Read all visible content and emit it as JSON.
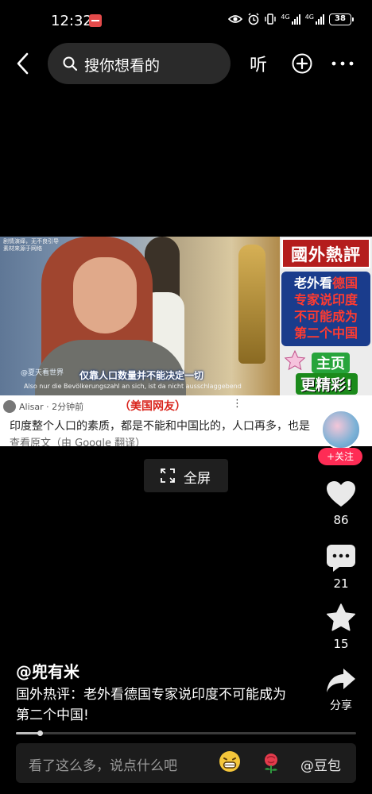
{
  "status_bar": {
    "time": "12:32",
    "network_1": "4G",
    "network_2": "4G",
    "battery": "38"
  },
  "top_bar": {
    "search_placeholder": "搜你想看的",
    "listen_label": "听"
  },
  "video": {
    "watermark_top": "剧情演绎，无不良引导\n素材来源于网络",
    "source_tag": "@夏天看世界",
    "caption": "仅靠人口数量并不能决定一切",
    "subtitle_de": "Also nur die Bevölkerungszahl an sich, ist da nicht ausschlaggebend",
    "promo_title": "國外熱評",
    "promo_line_1_a": "老外看",
    "promo_line_1_b": "德国",
    "promo_line_2": "专家说印度",
    "promo_line_3": "不可能成为",
    "promo_line_4": "第二个中国",
    "promo_home": "主页",
    "promo_more": "更精彩!",
    "comment_user": "Alisar · 2分钟前",
    "comment_tag": "（美国网友）",
    "comment_menu": "⋮",
    "comment_text": "印度整个人口的素质，都是不能和中国比的，人口再多，也是",
    "comment_translate": "查看原文（由 Google 翻译）"
  },
  "fullscreen": {
    "label": "全屏"
  },
  "rail": {
    "follow_label": "+关注",
    "likes": "86",
    "comments": "21",
    "favorites": "15",
    "share_label": "分享"
  },
  "info": {
    "author": "@兜有米",
    "description": "国外热评：老外看德国专家说印度不可能成为第二个中国!",
    "progress": 0.07
  },
  "comment_bar": {
    "placeholder": "看了这么多，说点什么吧",
    "mention_label": "@豆包"
  }
}
